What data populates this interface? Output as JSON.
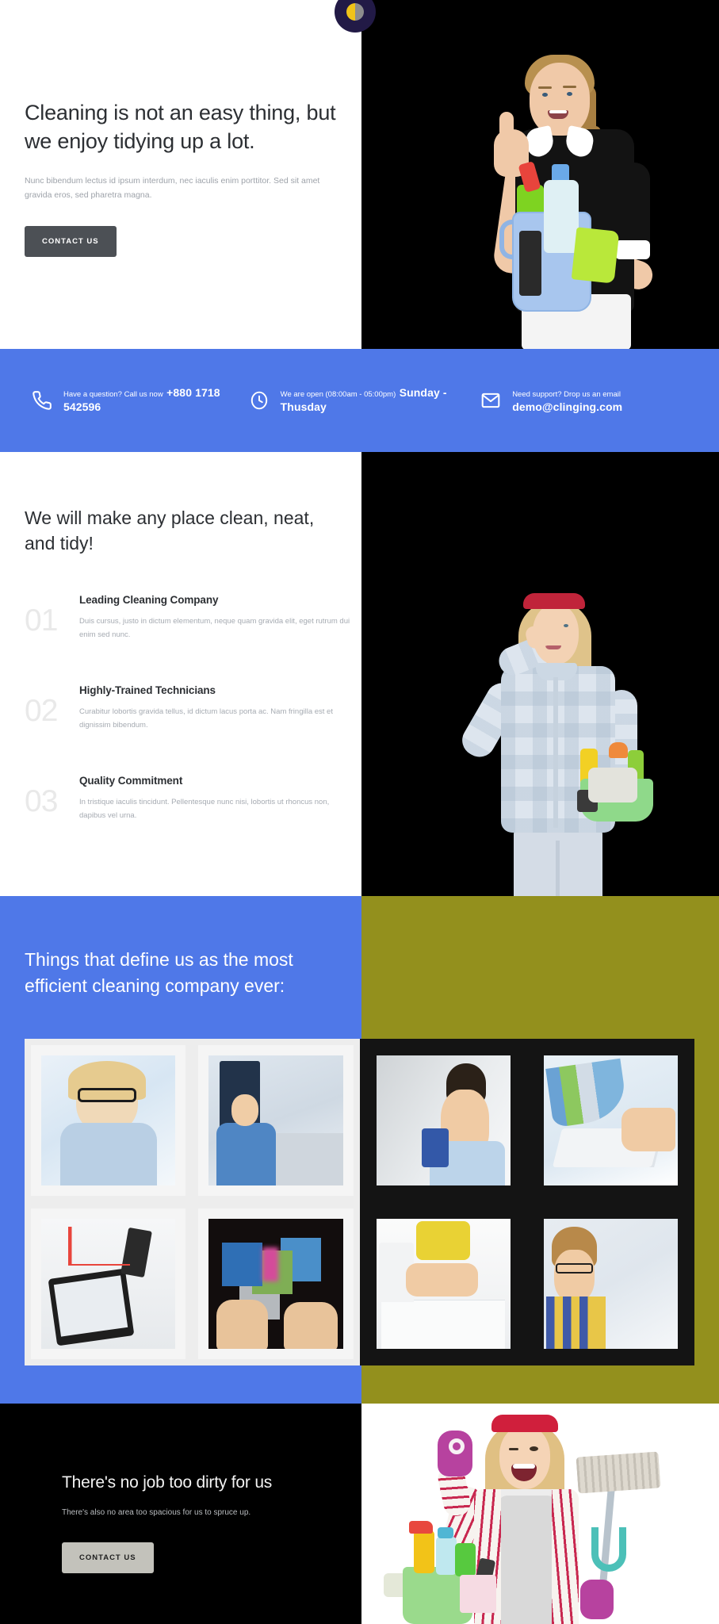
{
  "logo": {
    "name": "clinging-logo-badge"
  },
  "hero": {
    "title": "Cleaning is not an easy thing, but we enjoy tidying up a lot.",
    "subtitle": "Nunc bibendum lectus id ipsum interdum, nec iaculis enim porttitor. Sed sit amet gravida eros, sed pharetra magna.",
    "cta_label": "CONTACT US",
    "image_alt": "Smiling maid in black uniform giving a thumbs up while holding a blue bucket of cleaning supplies"
  },
  "contact_bar": {
    "background": "#4f78e8",
    "items": [
      {
        "icon": "phone-icon",
        "top": "Have a question? Call us now",
        "bottom": "+880 1718 542596"
      },
      {
        "icon": "clock-icon",
        "top": "We are open (08:00am - 05:00pm)",
        "bottom": "Sunday - Thusday"
      },
      {
        "icon": "mail-icon",
        "top": "Need support? Drop us an email",
        "bottom": "demo@clinging.com"
      }
    ]
  },
  "features": {
    "title": "We will make any place clean, neat, and tidy!",
    "image_alt": "Young woman in a plaid shirt and red headband saluting while carrying a basket of cleaning tools",
    "items": [
      {
        "number": "01",
        "heading": "Leading Cleaning Company",
        "body": "Duis cursus, justo in dictum elementum, neque quam gravida elit, eget rutrum dui enim sed nunc."
      },
      {
        "number": "02",
        "heading": "Highly-Trained Technicians",
        "body": "Curabitur lobortis gravida tellus, id dictum lacus porta ac. Nam fringilla est et dignissim bibendum."
      },
      {
        "number": "03",
        "heading": "Quality Commitment",
        "body": "In tristique iaculis tincidunt. Pellentesque nunc nisi, lobortis ut rhoncus non, dapibus vel urna."
      }
    ]
  },
  "gallery": {
    "heading": "Things that define us as the most efficient cleaning company ever:",
    "left_background": "#4f78e8",
    "right_background": "#93901d",
    "tiles": [
      {
        "alt": "Blonde woman with glasses smiling while writing at a bright desk",
        "frame": "light"
      },
      {
        "alt": "Businessman in blue shirt and tie seated at a conference table meeting",
        "frame": "light"
      },
      {
        "alt": "Young man in blue shirt holding a mug looking thoughtful",
        "frame": "dark"
      },
      {
        "alt": "Hands typing on a white laptop with colorful media fanning out of the screen",
        "frame": "dark"
      },
      {
        "alt": "Tablet and smartphone on printed business charts and reports",
        "frame": "light"
      },
      {
        "alt": "Two open hands projecting floating digital media screens",
        "frame": "light"
      },
      {
        "alt": "Team leaning over a desk reviewing documents beside a computer",
        "frame": "dark"
      },
      {
        "alt": "Smiling man in glasses and plaid shirt in a busy open-plan office",
        "frame": "dark"
      }
    ]
  },
  "cta": {
    "title": "There's no job too dirty for us",
    "subtitle": "There's also no area too spacious for us to spruce up.",
    "button_label": "CONTACT US",
    "image_alt": "Laughing woman in striped shirt and red headband making an OK sign with a purple glove while holding a mop"
  }
}
